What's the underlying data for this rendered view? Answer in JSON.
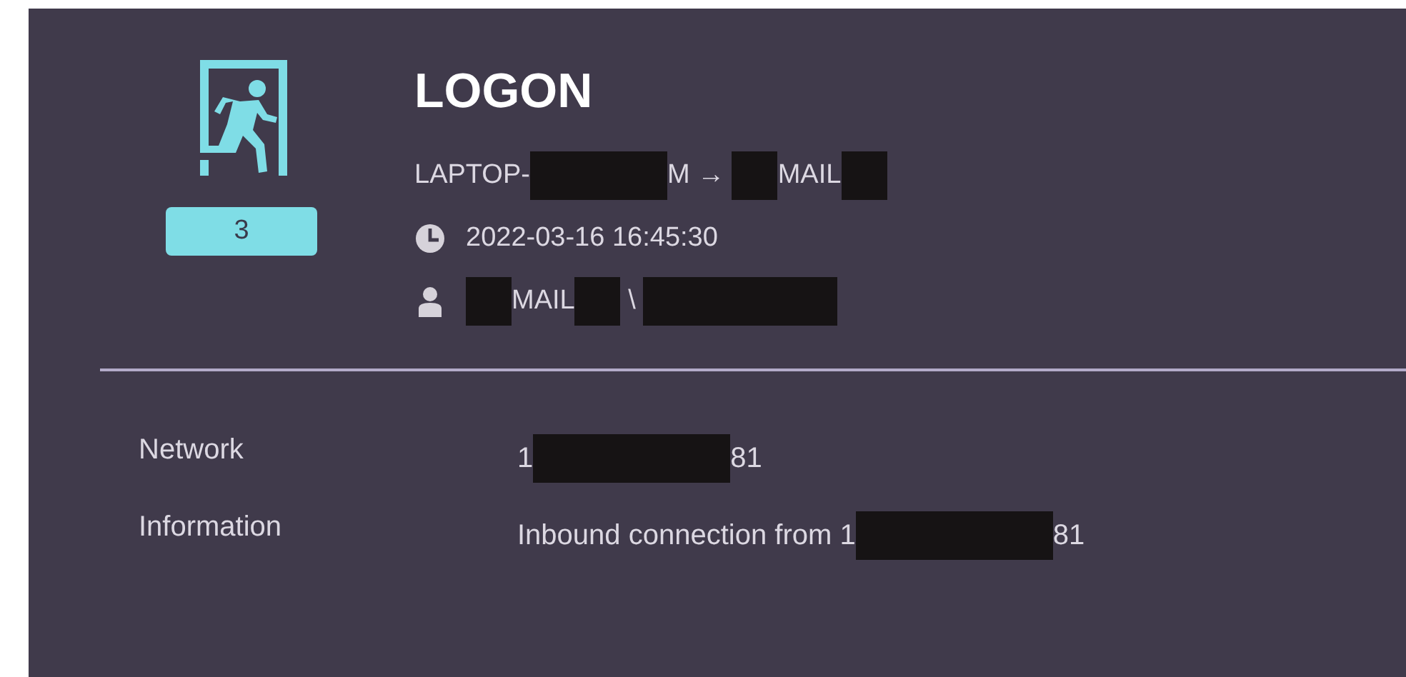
{
  "event": {
    "title": "LOGON",
    "count": "3",
    "route": [
      {
        "kind": "text",
        "text": "LAPTOP-"
      },
      {
        "kind": "redacted"
      },
      {
        "kind": "text",
        "text": "M → "
      },
      {
        "kind": "redacted"
      },
      {
        "kind": "text",
        "text": "MAIL"
      },
      {
        "kind": "redacted"
      }
    ],
    "time": "2022-03-16 16:45:30",
    "user": [
      {
        "kind": "redacted"
      },
      {
        "kind": "text",
        "text": "MAIL"
      },
      {
        "kind": "redacted"
      },
      {
        "kind": "text",
        "text": " \\ "
      },
      {
        "kind": "redacted"
      }
    ]
  },
  "details": [
    {
      "label": "Network",
      "value": [
        {
          "kind": "text",
          "text": "1"
        },
        {
          "kind": "redacted"
        },
        {
          "kind": "text",
          "text": "81"
        }
      ]
    },
    {
      "label": "Information",
      "value": [
        {
          "kind": "text",
          "text": "Inbound connection from 1"
        },
        {
          "kind": "redacted"
        },
        {
          "kind": "text",
          "text": "81"
        }
      ]
    }
  ]
}
